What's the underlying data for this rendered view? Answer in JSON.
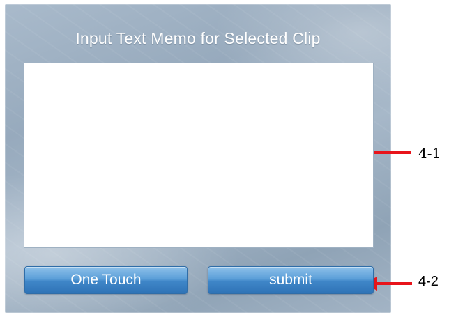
{
  "dialog": {
    "title": "Input Text Memo for Selected Clip",
    "memo": {
      "value": "",
      "placeholder": ""
    },
    "buttons": {
      "one_touch_label": "One Touch",
      "submit_label": "submit"
    }
  },
  "annotations": {
    "callout_1": "4-1",
    "callout_2": "4-2",
    "arrow_color": "#e8141b"
  },
  "colors": {
    "panel": "#a3b4c5",
    "button": "#3f86c8",
    "title_text": "#ffffff"
  }
}
